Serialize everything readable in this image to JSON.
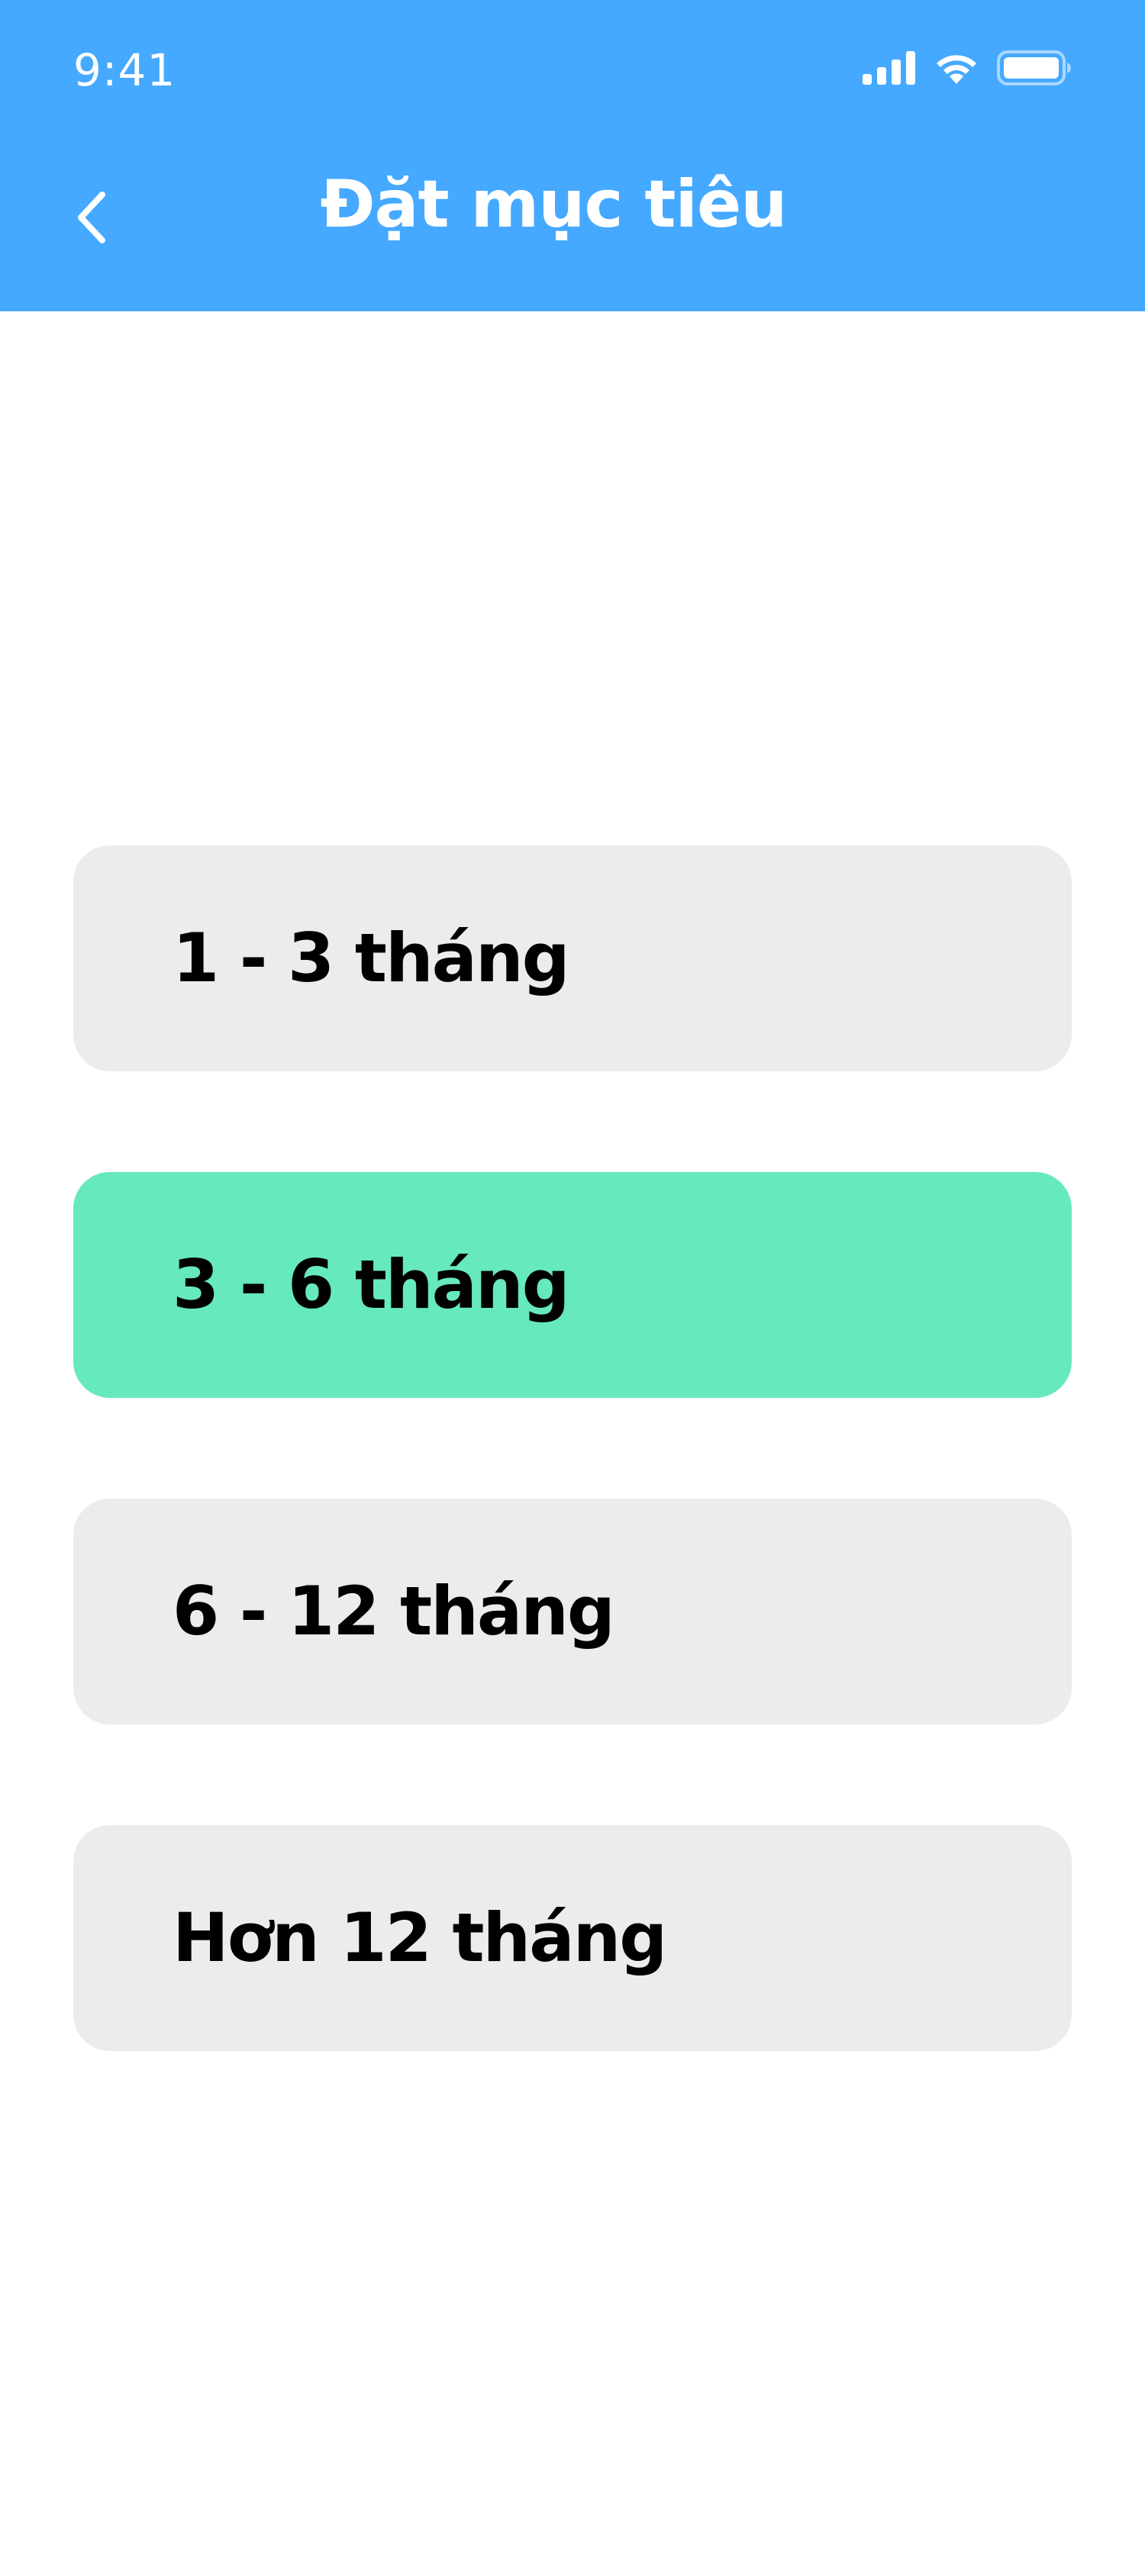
{
  "status_bar": {
    "time": "9:41",
    "signal_icon": "cellular-signal-icon",
    "wifi_icon": "wifi-icon",
    "battery_icon": "battery-icon"
  },
  "header": {
    "title": "Đặt mục tiêu",
    "back_icon": "chevron-left-icon",
    "background": "#45A9FF"
  },
  "options": [
    {
      "label": "1 - 3 tháng",
      "selected": false
    },
    {
      "label": "3 - 6 tháng",
      "selected": true
    },
    {
      "label": "6 - 12 tháng",
      "selected": false
    },
    {
      "label": "Hơn 12 tháng",
      "selected": false
    }
  ],
  "colors": {
    "option_default": "#EDEBEC",
    "option_selected": "#66E9BC",
    "text": "#000000"
  }
}
